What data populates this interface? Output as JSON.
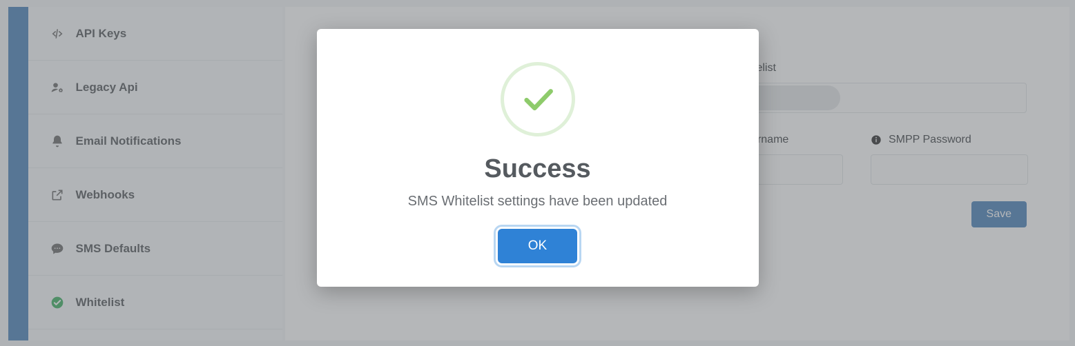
{
  "sidebar": {
    "items": [
      {
        "label": "API Keys"
      },
      {
        "label": "Legacy Api"
      },
      {
        "label": "Email Notifications"
      },
      {
        "label": "Webhooks"
      },
      {
        "label": "SMS Defaults"
      },
      {
        "label": "Whitelist"
      }
    ]
  },
  "form": {
    "email_whitelist_label": "Email Whitelist",
    "email_whitelist_value": "",
    "smpp_username_label": "SMPP Username",
    "smpp_username_value": "",
    "smpp_password_label": "SMPP Password",
    "smpp_password_value": "",
    "save_label": "Save"
  },
  "modal": {
    "title": "Success",
    "message": "SMS Whitelist settings have been updated",
    "ok_label": "OK"
  }
}
